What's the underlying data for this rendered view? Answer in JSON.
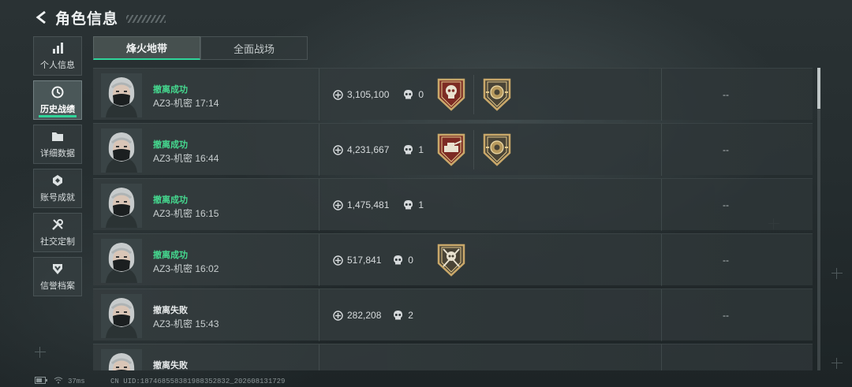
{
  "header": {
    "title": "角色信息"
  },
  "sidebar": {
    "items": [
      {
        "label": "个人信息",
        "icon": "bar-chart-icon",
        "active": false
      },
      {
        "label": "历史战绩",
        "icon": "history-clock-icon",
        "active": true
      },
      {
        "label": "详细数据",
        "icon": "folder-icon",
        "active": false
      },
      {
        "label": "账号成就",
        "icon": "medal-icon",
        "active": false
      },
      {
        "label": "社交定制",
        "icon": "tools-icon",
        "active": false
      },
      {
        "label": "信誉档案",
        "icon": "shield-badge-icon",
        "active": false
      }
    ]
  },
  "tabs": [
    {
      "label": "烽火地带",
      "active": true
    },
    {
      "label": "全面战场",
      "active": false
    }
  ],
  "colors": {
    "accent": "#2fd59a",
    "success": "#45d98f",
    "failure": "#e6e9ea"
  },
  "records": [
    {
      "outcome": "撤离成功",
      "success": true,
      "map_time": "AZ3-机密 17:14",
      "value": "3,105,100",
      "kills": "0",
      "badges": [
        "red-shield-skull-badge",
        "gold-emblem-badge"
      ],
      "extra": "--"
    },
    {
      "outcome": "撤离成功",
      "success": true,
      "map_time": "AZ3-机密 16:44",
      "value": "4,231,667",
      "kills": "1",
      "badges": [
        "red-tank-badge",
        "gold-emblem-badge"
      ],
      "extra": "--"
    },
    {
      "outcome": "撤离成功",
      "success": true,
      "map_time": "AZ3-机密 16:15",
      "value": "1,475,481",
      "kills": "1",
      "badges": [],
      "extra": "--"
    },
    {
      "outcome": "撤离成功",
      "success": true,
      "map_time": "AZ3-机密 16:02",
      "value": "517,841",
      "kills": "0",
      "badges": [
        "skull-crossed-rifles-badge"
      ],
      "extra": "--"
    },
    {
      "outcome": "撤离失败",
      "success": false,
      "map_time": "AZ3-机密 15:43",
      "value": "282,208",
      "kills": "2",
      "badges": [],
      "extra": "--"
    },
    {
      "outcome": "撤离失败",
      "success": false,
      "map_time": "",
      "value": "",
      "kills": "",
      "badges": [],
      "extra": ""
    }
  ],
  "status_bar": {
    "ping": "37ms",
    "uid": "CN UID:187468558381988352832_202608131729"
  }
}
